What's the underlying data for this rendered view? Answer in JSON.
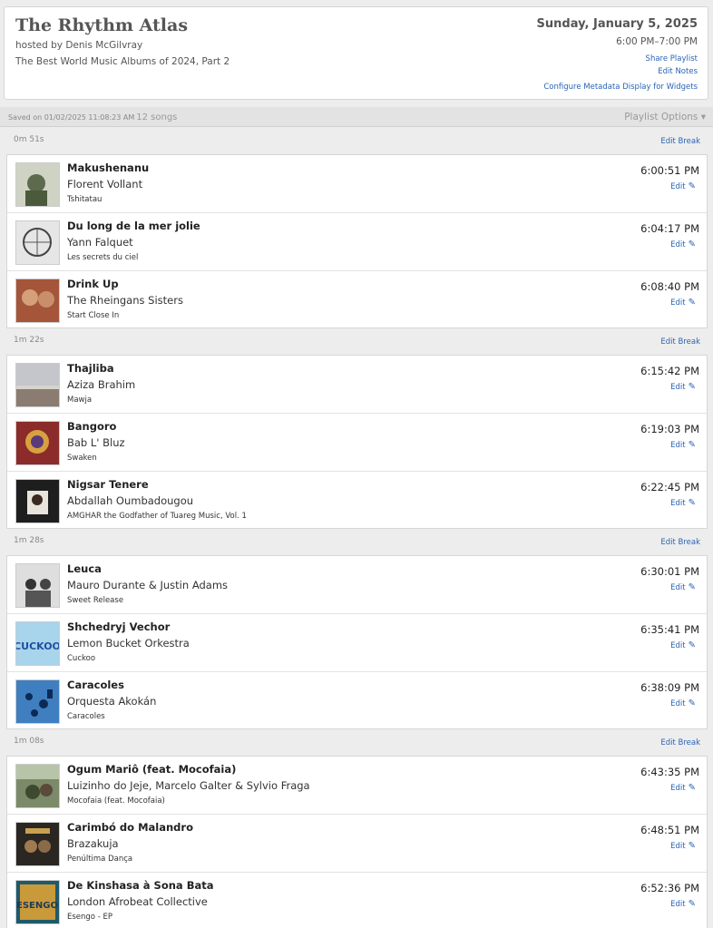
{
  "header": {
    "title": "The Rhythm Atlas",
    "host": "hosted by Denis McGilvray",
    "episode": "The Best World Music Albums of 2024, Part 2",
    "date": "Sunday, January 5, 2025",
    "time_range": "6:00 PM–7:00 PM",
    "share_label": "Share Playlist",
    "notes_label": "Edit Notes",
    "configure_label": "Configure Metadata Display for Widgets"
  },
  "savebar": {
    "saved_on": "Saved on 01/02/2025 11:08:23 AM",
    "song_count": "12 songs",
    "options_label": "Playlist Options ▾"
  },
  "edit_break_label": "Edit Break",
  "edit_label": "Edit",
  "icons": {
    "edit": "pencil-icon"
  },
  "breaks": [
    "0m 51s",
    "1m 22s",
    "1m 28s",
    "1m 08s"
  ],
  "songs": [
    {
      "title": "Makushenanu",
      "artist": "Florent Vollant",
      "album": "Tshitatau",
      "time": "6:00:51 PM",
      "art": "#8a9a7c"
    },
    {
      "title": "Du long de la mer jolie",
      "artist": "Yann Falquet",
      "album": "Les secrets du ciel",
      "time": "6:04:17 PM",
      "art": "#9a9a9a"
    },
    {
      "title": "Drink Up",
      "artist": "The Rheingans Sisters",
      "album": "Start Close In",
      "time": "6:08:40 PM",
      "art": "#a4553a"
    },
    {
      "title": "Thajliba",
      "artist": "Aziza Brahim",
      "album": "Mawja",
      "time": "6:15:42 PM",
      "art": "#a8a8ae"
    },
    {
      "title": "Bangoro",
      "artist": "Bab L' Bluz",
      "album": "Swaken",
      "time": "6:19:03 PM",
      "art": "#8b2c2a"
    },
    {
      "title": "Nigsar Tenere",
      "artist": "Abdallah Oumbadougou",
      "album": "AMGHAR the Godfather of Tuareg Music, Vol. 1",
      "time": "6:22:45 PM",
      "art": "#222222"
    },
    {
      "title": "Leuca",
      "artist": "Mauro Durante & Justin Adams",
      "album": "Sweet Release",
      "time": "6:30:01 PM",
      "art": "#d8d8d8"
    },
    {
      "title": "Shchedryj Vechor",
      "artist": "Lemon Bucket Orkestra",
      "album": "Cuckoo",
      "time": "6:35:41 PM",
      "art": "#9fcfe8"
    },
    {
      "title": "Caracoles",
      "artist": "Orquesta Akokán",
      "album": "Caracoles",
      "time": "6:38:09 PM",
      "art": "#3f7fc0"
    },
    {
      "title": "Ogum Mariô (feat. Mocofaia)",
      "artist": "Luizinho do Jeje, Marcelo Galter & Sylvio Fraga",
      "album": "Mocofaia (feat. Mocofaia)",
      "time": "6:43:35 PM",
      "art": "#6d7a5a"
    },
    {
      "title": "Carimbó do Malandro",
      "artist": "Brazakuja",
      "album": "Penúltima Dança",
      "time": "6:48:51 PM",
      "art": "#2a2622"
    },
    {
      "title": "De Kinshasa à Sona Bata",
      "artist": "London Afrobeat Collective",
      "album": "Esengo - EP",
      "time": "6:52:36 PM",
      "art": "#c89a3a"
    }
  ]
}
